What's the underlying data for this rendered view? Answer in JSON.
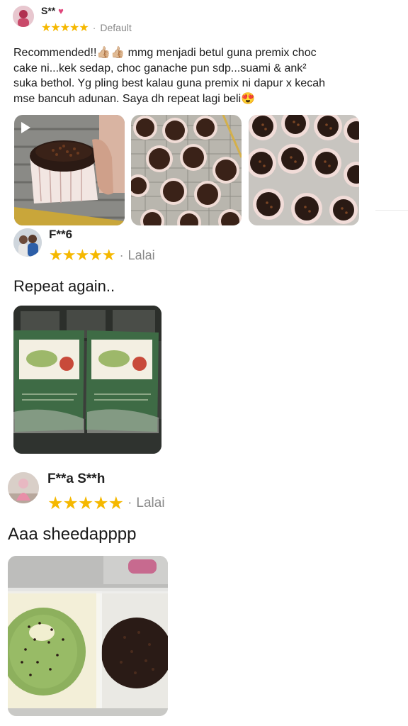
{
  "reviews": [
    {
      "user": "S**",
      "stars": "★★★★★",
      "variant": "Default",
      "text_lines": [
        "Recommended!!👍🏼👍🏼 mmg menjadi betul guna premix choc",
        "cake ni...kek sedap, choc ganache pun sdp...suami & ank²",
        "suka bethol. Yg pling best kalau guna premix ni dapur x kecah",
        "mse bancuh adunan. Saya dh repeat lagi beli😍"
      ]
    },
    {
      "user": "F**6",
      "stars": "★★★★★",
      "variant": "Lalai",
      "text": "Repeat again.."
    },
    {
      "user": "F**a S**h",
      "stars": "★★★★★",
      "variant": "Lalai",
      "text": "Aaa sheedapppp"
    }
  ],
  "separator": "·",
  "colors": {
    "star": "#f5b800",
    "muted": "#888888"
  }
}
